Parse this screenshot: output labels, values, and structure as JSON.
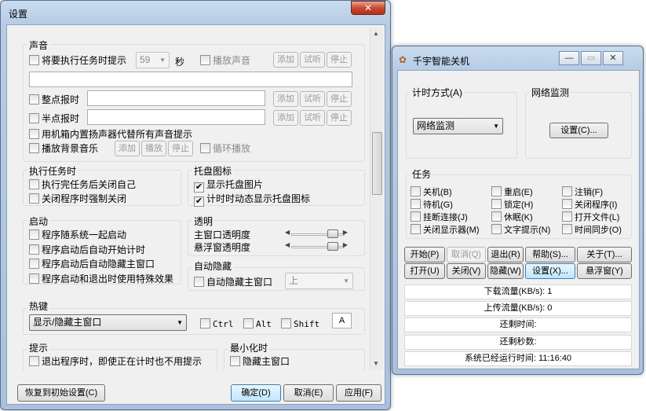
{
  "settings_window": {
    "title": "设置",
    "close": "✕",
    "sound": {
      "header": "声音",
      "task_prompt": "将要执行任务时提示",
      "seconds_value": "59",
      "seconds_unit": "秒",
      "play_sound": "播放声音",
      "add": "添加",
      "listen": "试听",
      "stop": "停止",
      "hourly": "整点报时",
      "half_hour": "半点报时",
      "pc_speaker": "用机箱内置扬声器代替所有声音提示",
      "bg_music": "播放背景音乐",
      "play": "播放",
      "loop": "循环播放"
    },
    "exec": {
      "header": "执行任务时",
      "close_self": "执行完任务后关闭自己",
      "force_close": "关闭程序时强制关闭"
    },
    "tray": {
      "header": "托盘图标",
      "show_icon": "显示托盘图片",
      "dynamic": "计时时动态显示托盘图标"
    },
    "startup": {
      "header": "启动",
      "with_system": "程序随系统一起启动",
      "auto_timer": "程序启动后自动开始计时",
      "auto_hide": "程序启动后自动隐藏主窗口",
      "effects": "程序启动和退出时使用特殊效果"
    },
    "transparency": {
      "header": "透明",
      "main": "主窗口透明度",
      "float": "悬浮窗透明度"
    },
    "autohide": {
      "header": "自动隐藏",
      "auto_hide_main": "自动隐藏主窗口",
      "position": "上"
    },
    "hotkey": {
      "header": "热键",
      "action": "显示/隐藏主窗口",
      "ctrl": "Ctrl",
      "alt": "Alt",
      "shift": "Shift",
      "key": "A"
    },
    "prompt": {
      "header": "提示",
      "exit_no_prompt": "退出程序时，即使正在计时也不用提示"
    },
    "minimize": {
      "header": "最小化时",
      "hide_main": "隐藏主窗口"
    },
    "buttons": {
      "restore": "恢复到初始设置(C)",
      "ok": "确定(D)",
      "cancel": "取消(E)",
      "apply": "应用(F)"
    }
  },
  "main_window": {
    "title": "千宇智能关机",
    "timing": {
      "header": "计时方式(A)",
      "mode": "网络监测"
    },
    "net": {
      "header": "网络监测",
      "settings": "设置(C)..."
    },
    "tasks": {
      "header": "任务",
      "items": [
        "关机(B)",
        "重启(E)",
        "注销(F)",
        "待机(G)",
        "锁定(H)",
        "关闭程序(I)",
        "挂断连接(J)",
        "休眠(K)",
        "打开文件(L)",
        "关闭显示器(M)",
        "文字提示(N)",
        "时间同步(O)"
      ]
    },
    "buttons": [
      "开始(P)",
      "取消(Q)",
      "退出(R)",
      "帮助(S)...",
      "关于(T)...",
      "打开(U)",
      "关闭(V)",
      "隐藏(W)",
      "设置(X)...",
      "悬浮窗(Y)"
    ],
    "status": {
      "download": "下载流量(KB/s): 1",
      "upload": "上传流量(KB/s): 0",
      "remain_time": "还剩时间:",
      "remain_seconds": "还剩秒数:",
      "uptime": "系统已经运行时间: 11:16:40"
    }
  },
  "colors": {
    "accent": "#3c7fb1",
    "close_button": "#c84b32",
    "client_bg": "#f0f0f0"
  }
}
